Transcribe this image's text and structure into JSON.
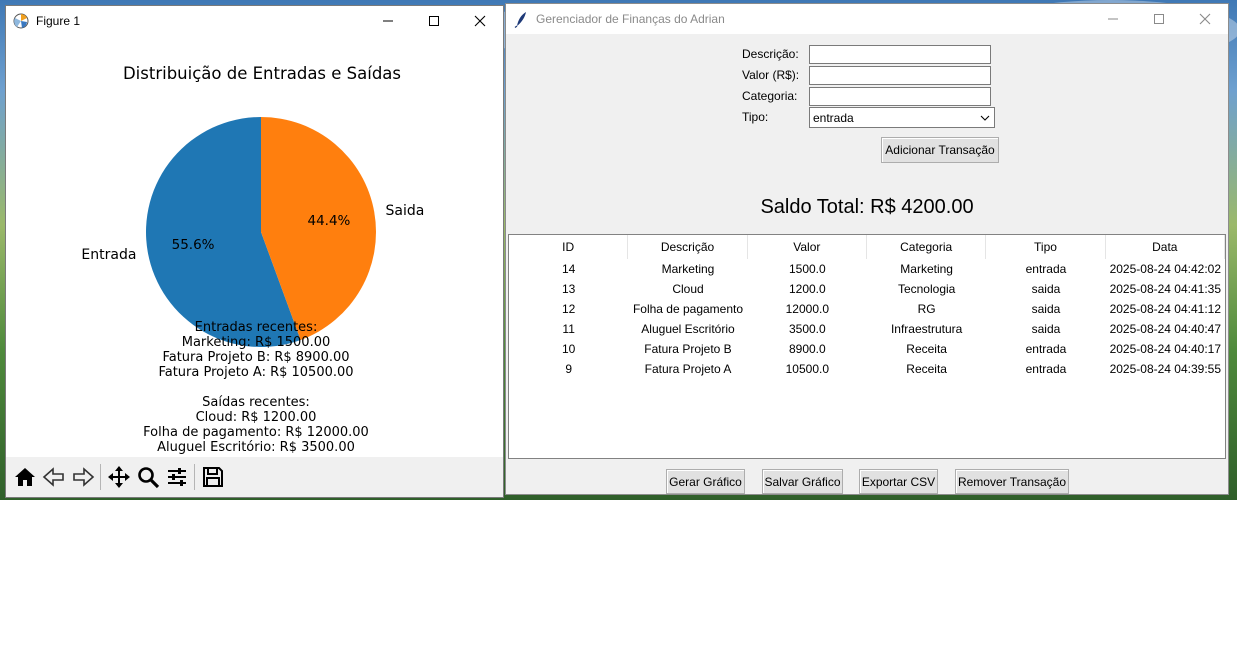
{
  "figure_window": {
    "title": "Figure 1",
    "chart_title": "Distribuição de Entradas e Saídas",
    "summary_lines": [
      "Entradas recentes:",
      "Marketing: R$ 1500.00",
      "Fatura Projeto B: R$ 8900.00",
      "Fatura Projeto A: R$ 10500.00",
      "",
      "Saídas recentes:",
      "Cloud: R$ 1200.00",
      "Folha de pagamento: R$ 12000.00",
      "Aluguel Escritório: R$ 3500.00"
    ],
    "toolbar": [
      "home-icon",
      "back-icon",
      "forward-icon",
      "pan-icon",
      "zoom-icon",
      "configure-subplots-icon",
      "save-icon"
    ]
  },
  "chart_data": {
    "type": "pie",
    "title": "Distribuição de Entradas e Saídas",
    "labels": [
      "Entrada",
      "Saida"
    ],
    "values": [
      55.6,
      44.4
    ],
    "value_labels": [
      "55.6%",
      "44.4%"
    ],
    "colors": [
      "#1f77b4",
      "#ff7f0e"
    ]
  },
  "app_window": {
    "title": "Gerenciador de Finanças do Adrian",
    "form": {
      "descricao_label": "Descrição:",
      "valor_label": "Valor (R$):",
      "categoria_label": "Categoria:",
      "tipo_label": "Tipo:",
      "descricao_value": "",
      "valor_value": "",
      "categoria_value": "",
      "tipo_value": "entrada"
    },
    "add_button": "Adicionar Transação",
    "saldo": "Saldo Total: R$ 4200.00",
    "table": {
      "columns": [
        "ID",
        "Descrição",
        "Valor",
        "Categoria",
        "Tipo",
        "Data"
      ],
      "rows": [
        [
          "14",
          "Marketing",
          "1500.0",
          "Marketing",
          "entrada",
          "2025-08-24 04:42:02"
        ],
        [
          "13",
          "Cloud",
          "1200.0",
          "Tecnologia",
          "saida",
          "2025-08-24 04:41:35"
        ],
        [
          "12",
          "Folha de pagamento",
          "12000.0",
          "RG",
          "saida",
          "2025-08-24 04:41:12"
        ],
        [
          "11",
          "Aluguel Escritório",
          "3500.0",
          "Infraestrutura",
          "saida",
          "2025-08-24 04:40:47"
        ],
        [
          "10",
          "Fatura Projeto B",
          "8900.0",
          "Receita",
          "entrada",
          "2025-08-24 04:40:17"
        ],
        [
          "9",
          "Fatura Projeto A",
          "10500.0",
          "Receita",
          "entrada",
          "2025-08-24 04:39:55"
        ]
      ]
    },
    "bottom_buttons": {
      "gerar": "Gerar Gráfico",
      "salvar": "Salvar Gráfico",
      "exportar": "Exportar CSV",
      "remover": "Remover Transação"
    }
  }
}
